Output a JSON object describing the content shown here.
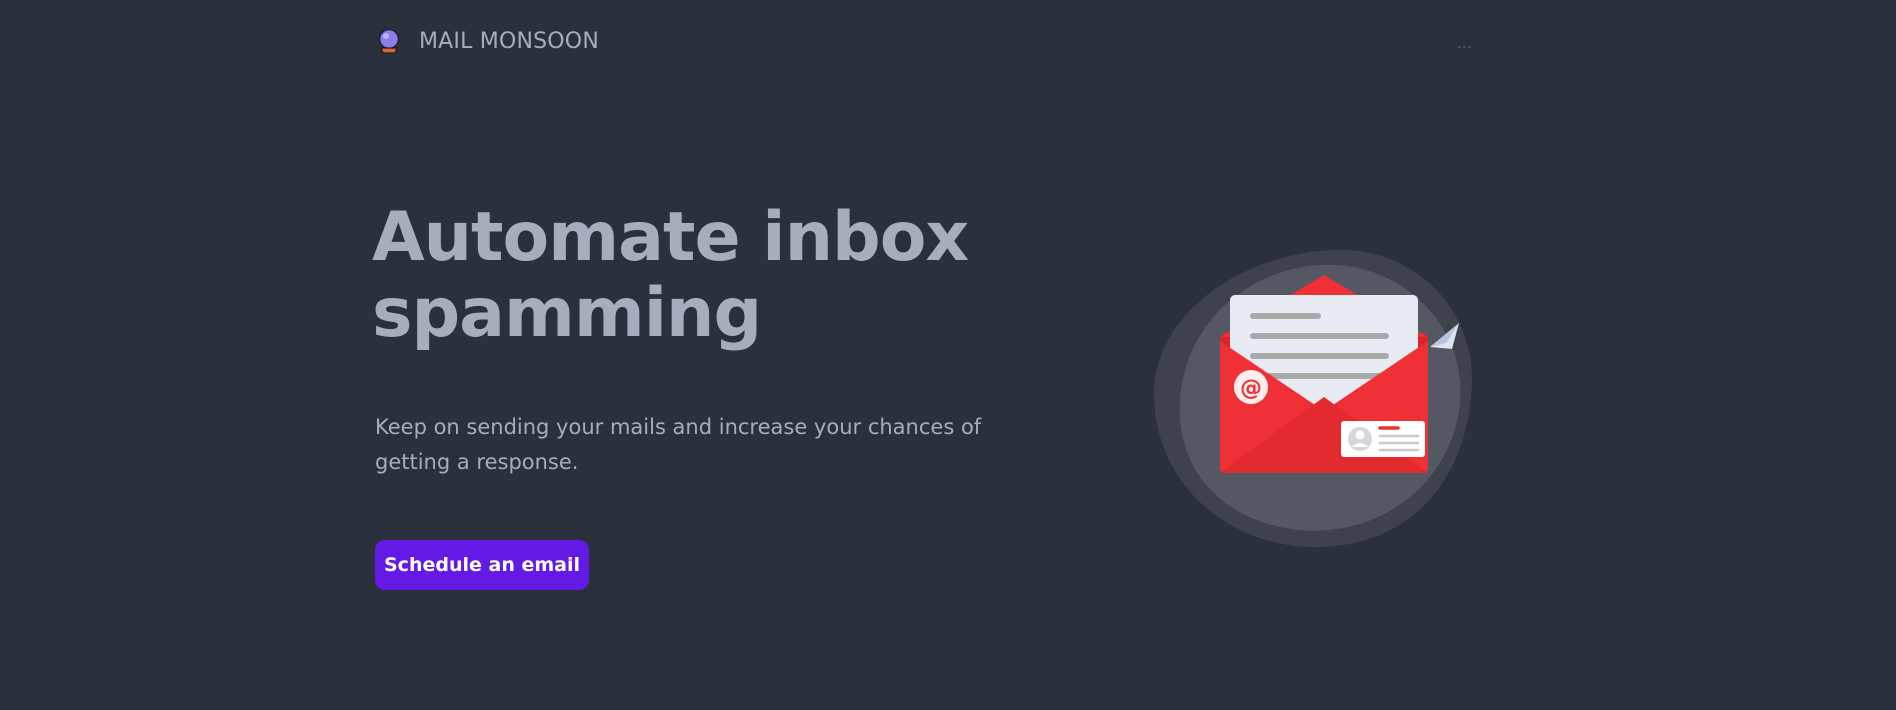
{
  "brand": {
    "name": "MAIL MONSOON",
    "logo_icon": "crystal-ball-icon"
  },
  "nav": {
    "menu_icon": "ellipsis-icon"
  },
  "hero": {
    "title_line1": "Automate inbox",
    "title_line2": "spamming",
    "subtitle_line1": "Keep on sending your mails and increase your chances of",
    "subtitle_line2": "getting a response.",
    "cta_label": "Schedule an email"
  },
  "illustration": {
    "icon": "open-envelope-icon",
    "at_symbol": "@"
  },
  "colors": {
    "background": "#2a303c",
    "text": "#a6adbb",
    "accent": "#641ae6",
    "envelope_red": "#ef3034"
  }
}
